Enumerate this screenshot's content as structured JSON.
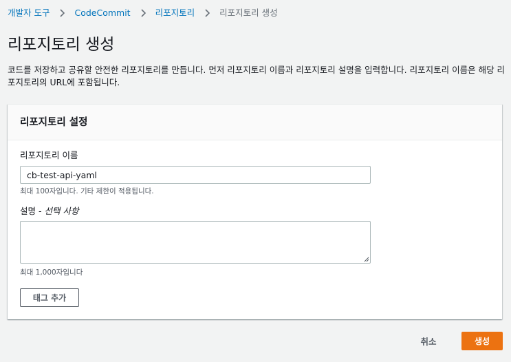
{
  "breadcrumb": {
    "items": [
      "개발자 도구",
      "CodeCommit",
      "리포지토리"
    ],
    "current": "리포지토리 생성"
  },
  "page": {
    "title": "리포지토리 생성",
    "description": "코드를 저장하고 공유할 안전한 리포지토리를 만듭니다. 먼저 리포지토리 이름과 리포지토리 설명을 입력합니다. 리포지토리 이름은 해당 리포지토리의 URL에 포함됩니다."
  },
  "settings": {
    "title": "리포지토리 설정",
    "name_label": "리포지토리 이름",
    "name_value": "cb-test-api-yaml",
    "name_hint": "최대 100자입니다. 기타 제한이 적용됩니다.",
    "desc_label": "설명 - ",
    "desc_optional": "선택 사항",
    "desc_value": "",
    "desc_hint": "최대 1,000자입니다",
    "add_tag_label": "태그 추가"
  },
  "footer": {
    "cancel_label": "취소",
    "create_label": "생성"
  },
  "colors": {
    "link": "#0073bb",
    "primary": "#ec7211",
    "background": "#f2f3f3"
  }
}
